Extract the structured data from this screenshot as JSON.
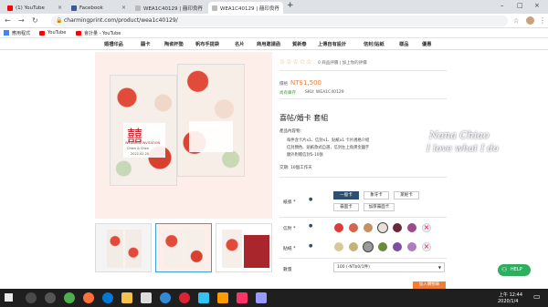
{
  "tabs": [
    {
      "title": "(1) YouTube",
      "color": "#ff0000"
    },
    {
      "title": "Facebook",
      "color": "#3b5998"
    },
    {
      "title": "WEA1C40129 | 囍印良行",
      "color": "#999999"
    },
    {
      "title": "WEA1C40129 | 囍印良行",
      "color": "#999999"
    }
  ],
  "new_tab": "+",
  "address": {
    "url": "charmingprint.com/product/wea1c40129/"
  },
  "bookmarks": [
    "應用程式",
    "YouTube",
    "會計量 - YouTube"
  ],
  "menu": [
    "婚禮印品",
    "囍卡",
    "陶瓷杯墊",
    "帆布手提袋",
    "名片",
    "商用邀請函",
    "賀新春",
    "上傳自有設計",
    "信封/貼紙",
    "樣品",
    "優惠"
  ],
  "product": {
    "rating_text": "0 商品評價 | 加上你的評價",
    "price_label": "價格",
    "price": "NT$1,500",
    "stock": "尚有庫存",
    "sku": "SKU: WEA1C40129",
    "title": "喜帖/婚卡 套組",
    "contents_label": "產品內容物:",
    "bullets": [
      "每件含卡片x1、信封x1、貼紙x1 卡片規格介紹",
      "信封顏色、貼紙款式自選，信封左上角燙金囍字",
      "額外附贈信封5-10張"
    ],
    "lead_time": "交期: 10個工作天",
    "paper_label": "紙張 *",
    "paper_options": [
      "一般卡",
      "象牙卡",
      "萊妮卡",
      "霧面卡",
      "加厚霧面卡"
    ],
    "envelope_label": "信封 *",
    "envelope_colors": [
      "#e03a3a",
      "#d4654a",
      "#c79060",
      "#e9e0d8",
      "#6a2a3a",
      "#9b4a8a",
      "#f3f3f3"
    ],
    "sticker_label": "貼紙 *",
    "sticker_colors": [
      "#d9c79a",
      "#c8b27a",
      "#9a9a9a",
      "#6b8a3a",
      "#7a4fa0",
      "#b07cc0",
      "#f3f3f3"
    ],
    "qty_label": "數量",
    "qty_value": "100 (-NT$0/1件)",
    "button": "加入購物車"
  },
  "card_text": {
    "invite": "WEDDING INVITATION",
    "names": "Chien & Chen",
    "date": "2022.02.20"
  },
  "overlay": {
    "line1": "Nana Chiao",
    "line2": "I love what I do"
  },
  "help": "HELP",
  "taskbar": {
    "time": "上午 12:44",
    "date": "2020/1/4"
  }
}
